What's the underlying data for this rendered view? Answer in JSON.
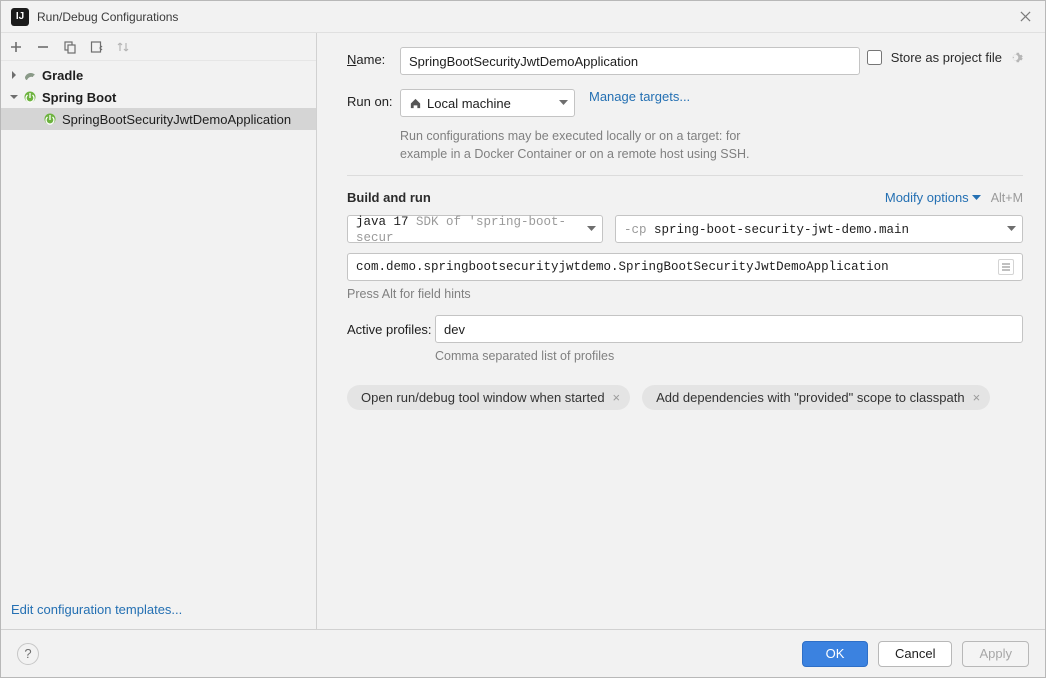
{
  "window": {
    "title": "Run/Debug Configurations"
  },
  "sidebar": {
    "nodes": {
      "gradle": {
        "label": "Gradle"
      },
      "springboot": {
        "label": "Spring Boot"
      },
      "config": {
        "label": "SpringBootSecurityJwtDemoApplication"
      }
    },
    "edit_templates": "Edit configuration templates..."
  },
  "form": {
    "name_label": "Name:",
    "name_value": "SpringBootSecurityJwtDemoApplication",
    "store_label": "Store as project file",
    "runon_label": "Run on:",
    "runon_value": "Local machine",
    "manage_targets": "Manage targets...",
    "runon_hint1": "Run configurations may be executed locally or on a target: for",
    "runon_hint2": "example in a Docker Container or on a remote host using SSH.",
    "section_build": "Build and run",
    "modify_options": "Modify options",
    "modify_kbd": "Alt+M",
    "jdk_prefix": "java 17",
    "jdk_rest": " SDK of 'spring-boot-secur",
    "cp_prefix": "-cp",
    "cp_rest": " spring-boot-security-jwt-demo.main",
    "main_class": "com.demo.springbootsecurityjwtdemo.SpringBootSecurityJwtDemoApplication",
    "alt_hint": "Press Alt for field hints",
    "profiles_label": "Active profiles:",
    "profiles_value": "dev",
    "profiles_hint": "Comma separated list of profiles",
    "chip1": "Open run/debug tool window when started",
    "chip2": "Add dependencies with \"provided\" scope to classpath"
  },
  "footer": {
    "ok": "OK",
    "cancel": "Cancel",
    "apply": "Apply"
  }
}
